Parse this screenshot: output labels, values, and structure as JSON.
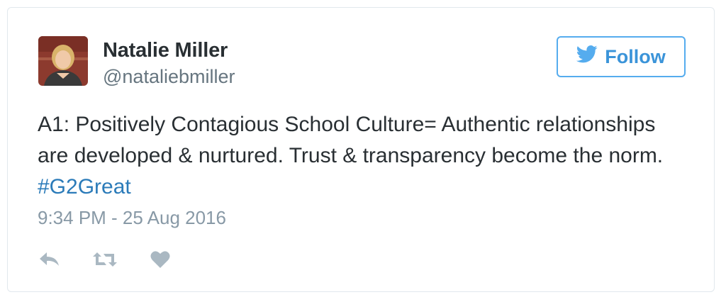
{
  "author": {
    "display_name": "Natalie Miller",
    "handle": "@nataliebmiller"
  },
  "follow_button": {
    "label": "Follow",
    "icon": "twitter-bird-icon"
  },
  "tweet": {
    "text": "A1: Positively Contagious School Culture= Authentic relationships are developed & nurtured. Trust & transparency become the norm. ",
    "hashtag": "#G2Great",
    "timestamp": "9:34 PM - 25 Aug 2016"
  },
  "actions": [
    {
      "icon": "reply-icon"
    },
    {
      "icon": "retweet-icon"
    },
    {
      "icon": "heart-icon"
    }
  ],
  "colors": {
    "accent": "#55acee",
    "link": "#2b7bb9",
    "text": "#292f33",
    "muted": "#8899a6",
    "border": "#e1e8ed"
  }
}
